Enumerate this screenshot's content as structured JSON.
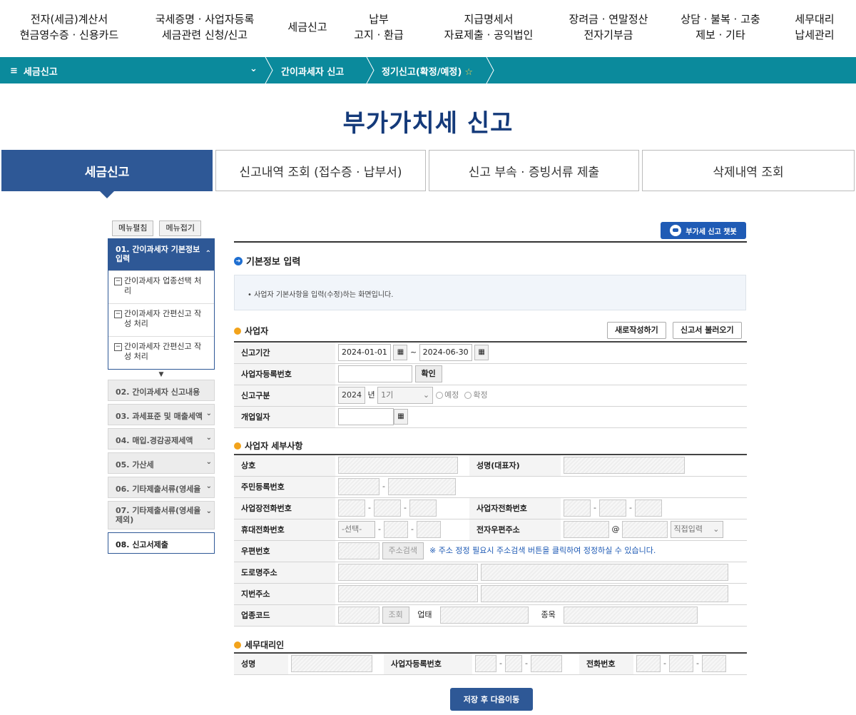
{
  "topnav": [
    {
      "line1": "전자(세금)계산서",
      "line2": "현금영수증 · 신용카드"
    },
    {
      "line1": "국세증명 · 사업자등록",
      "line2": "세금관련 신청/신고"
    },
    {
      "line1": "세금신고",
      "line2": ""
    },
    {
      "line1": "납부",
      "line2": "고지 · 환급"
    },
    {
      "line1": "지급명세서",
      "line2": "자료제출 · 공익법인"
    },
    {
      "line1": "장려금 · 연말정산",
      "line2": "전자기부금"
    },
    {
      "line1": "상담 · 불복 · 고충",
      "line2": "제보 · 기타"
    },
    {
      "line1": "세무대리",
      "line2": "납세관리"
    }
  ],
  "breadcrumb": {
    "menu_icon": "≡",
    "menu": "세금신고",
    "c1": "간이과세자 신고",
    "c2": "정기신고(확정/예정)",
    "star": "☆"
  },
  "page_title": "부가가치세 신고",
  "tabs": [
    "세금신고",
    "신고내역 조회 (접수증 · 납부서)",
    "신고 부속 · 증빙서류 제출",
    "삭제내역 조회"
  ],
  "sidebar": {
    "expand": "메뉴펼침",
    "collapse": "메뉴접기",
    "open_group": "01. 간이과세자 기본정보 입력",
    "subitems": [
      "간이과세자 업종선택 처리",
      "간이과세자 간편신고 작성 처리",
      "간이과세자 간편신고 작성 처리"
    ],
    "groups": [
      "02. 간이과세자 신고내용",
      "03. 과세표준 및 매출세액",
      "04. 매입.경감공제세액",
      "05. 가산세",
      "06. 기타제출서류(영세율",
      "07. 기타제출서류(영세율 제외)",
      "08. 신고서제출"
    ]
  },
  "chatbot": "부가세 신고 챗봇",
  "section_basic": "기본정보 입력",
  "notice": "• 사업자 기본사항을 입력(수정)하는 화면입니다.",
  "section_biz": "사업자",
  "btn_new": "새로작성하기",
  "btn_load": "신고서 불러오기",
  "biz": {
    "period_label": "신고기간",
    "period_from": "2024-01-01",
    "period_to": "2024-06-30",
    "regno_label": "사업자등록번호",
    "confirm": "확인",
    "type_label": "신고구분",
    "year": "2024",
    "year_unit": "년",
    "term": "1기",
    "opt1": "예정",
    "opt2": "확정",
    "open_label": "개업일자"
  },
  "section_detail": "사업자 세부사항",
  "detail": {
    "name": "상호",
    "ceo": "성명(대표자)",
    "rrn": "주민등록번호",
    "biz_tel": "사업장전화번호",
    "biz_tel2": "사업자전화번호",
    "mobile": "휴대전화번호",
    "mobile_sel": "-선택-",
    "email": "전자우편주소",
    "at": "@",
    "email_sel": "직접입력",
    "zip": "우편번호",
    "addr_search": "주소검색",
    "zip_hint": "※ 주소 정정 필요시 주소검색 버튼을 클릭하여 정정하실 수 있습니다.",
    "road": "도로명주소",
    "jibun": "지번주소",
    "industry": "업종코드",
    "lookup": "조회",
    "biz_type": "업태",
    "item": "종목"
  },
  "section_agent": "세무대리인",
  "agent": {
    "name": "성명",
    "regno": "사업자등록번호",
    "tel": "전화번호"
  },
  "save": "저장 후 다음이동"
}
